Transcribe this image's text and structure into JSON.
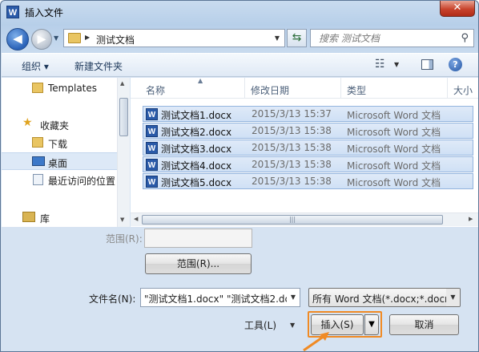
{
  "window": {
    "app_icon": "W",
    "title": "插入文件",
    "close": "✕"
  },
  "navigation": {
    "back_glyph": "◀",
    "forward_glyph": "▶",
    "address_path": "测试文档",
    "search_placeholder": "搜索 测试文档"
  },
  "toolbar": {
    "organize_label": "组织 ▾",
    "new_folder_label": "新建文件夹",
    "help_label": "?"
  },
  "sidebar": {
    "items": [
      {
        "label": "Templates",
        "icon": "folder-icon"
      },
      {
        "label": "收藏夹",
        "icon": "star-icon"
      },
      {
        "label": "下载",
        "icon": "download-folder-icon"
      },
      {
        "label": "桌面",
        "icon": "desktop-icon"
      },
      {
        "label": "最近访问的位置",
        "icon": "recent-places-icon"
      },
      {
        "label": "库",
        "icon": "library-icon"
      }
    ]
  },
  "file_list": {
    "columns": [
      "名称",
      "修改日期",
      "类型",
      "大小"
    ],
    "rows": [
      {
        "name": "测试文档1.docx",
        "date": "2015/3/13 15:37",
        "type": "Microsoft Word 文档"
      },
      {
        "name": "测试文档2.docx",
        "date": "2015/3/13 15:38",
        "type": "Microsoft Word 文档"
      },
      {
        "name": "测试文档3.docx",
        "date": "2015/3/13 15:38",
        "type": "Microsoft Word 文档"
      },
      {
        "name": "测试文档4.docx",
        "date": "2015/3/13 15:38",
        "type": "Microsoft Word 文档"
      },
      {
        "name": "测试文档5.docx",
        "date": "2015/3/13 15:38",
        "type": "Microsoft Word 文档"
      }
    ]
  },
  "lower": {
    "range_label": "范围(R):",
    "range_button": "范围(R)...",
    "filename_label": "文件名(N):",
    "filename_value": "\"测试文档1.docx\" \"测试文档2.dc",
    "filter_value": "所有 Word 文档(*.docx;*.docm",
    "tools_label": "工具(L)",
    "insert_label": "插入(S)",
    "cancel_label": "取消"
  },
  "colors": {
    "highlight": "#f08a24",
    "selection": "#cfe0f5"
  }
}
